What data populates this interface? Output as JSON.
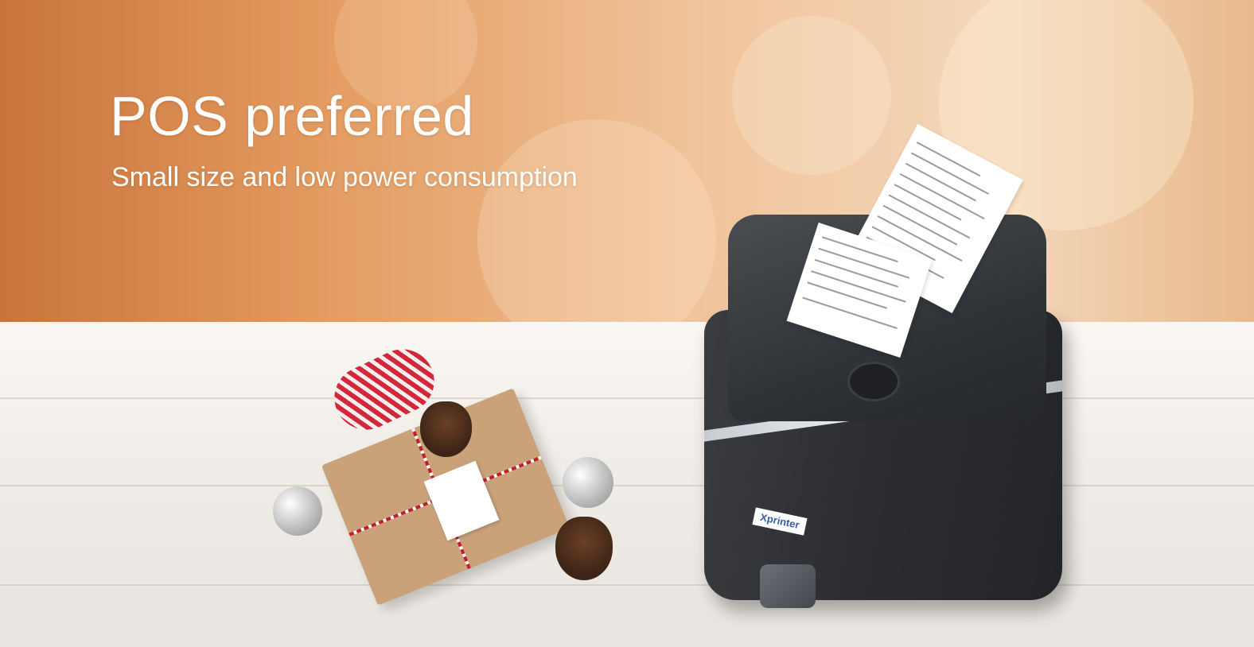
{
  "banner": {
    "title": "POS preferred",
    "subtitle": "Small size and low power consumption"
  },
  "product": {
    "brand_label": "Xprinter"
  },
  "colors": {
    "background_warm": "#e39a5f",
    "text": "#ffffff",
    "printer_body": "#2b2d31"
  }
}
